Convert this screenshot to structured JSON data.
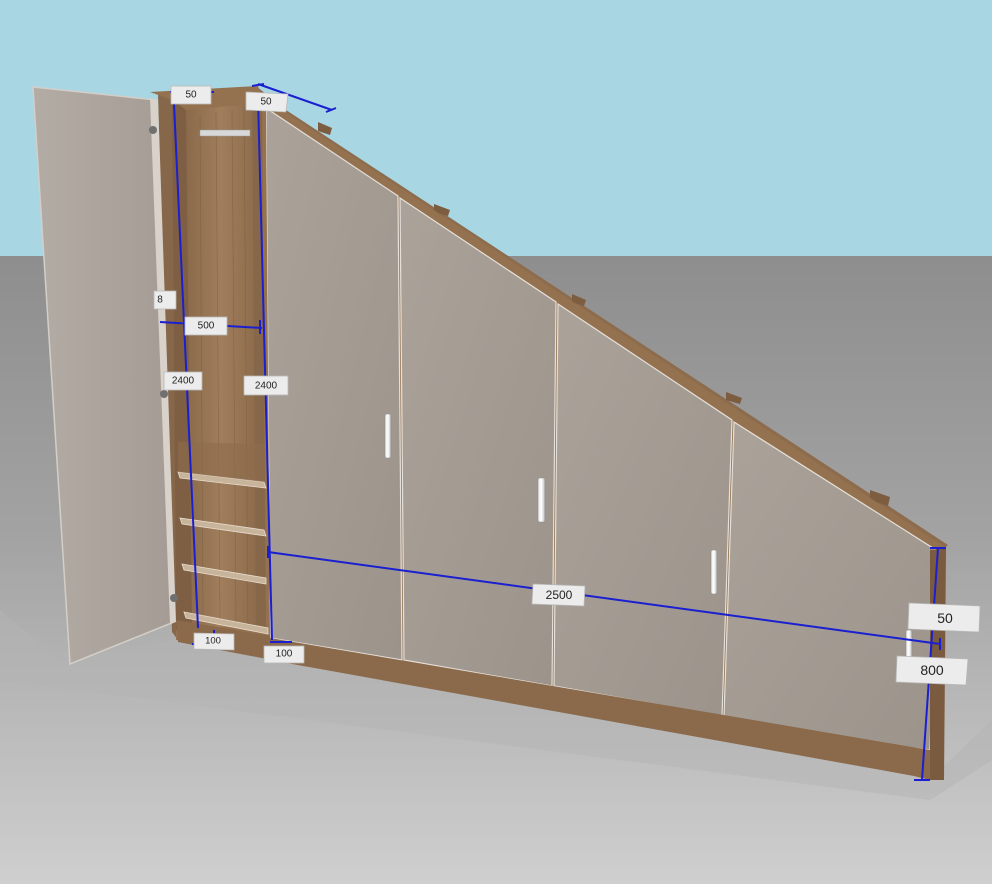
{
  "scene": {
    "colors": {
      "sky": "#a8d6e3",
      "floor_far": "#8e8e8e",
      "floor_near": "#c9c9c9",
      "wood": "#9a7856",
      "wood_dark": "#7a5b3f",
      "door_panel": "#a69d94",
      "dimension_line": "#1a1fd0"
    },
    "icons": [
      "door-handle-icon",
      "hinge-icon"
    ]
  },
  "dimensions": {
    "top_left_width": "50",
    "top_right_width": "50",
    "left_edge_cut": "8",
    "column_depth": "500",
    "left_height": "2400",
    "inner_height": "2400",
    "plinth_left": "100",
    "plinth_right": "100",
    "total_width": "2500",
    "right_top_thickness": "50",
    "right_height": "800"
  }
}
